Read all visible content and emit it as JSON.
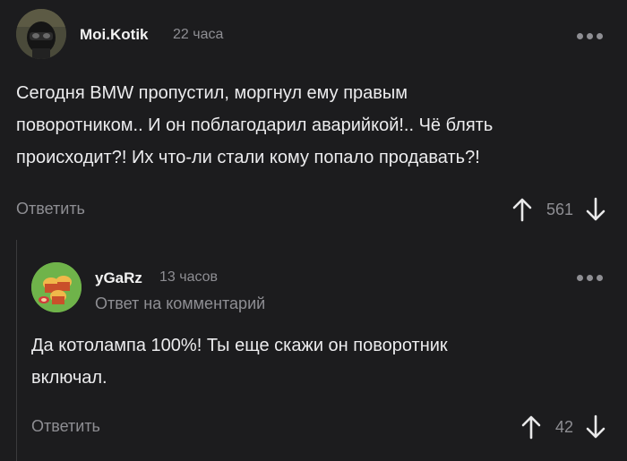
{
  "comments": [
    {
      "author": "Moi.Kotik",
      "time": "22 часа",
      "text": "Сегодня BMW пропустил, моргнул ему правым\nповоротником.. И он поблагодарил аварийкой!.. Чё блять\nпроисходит?! Их что-ли стали кому попало продавать?!",
      "reply_label": "Ответить",
      "score": "561"
    },
    {
      "author": "yGaRz",
      "time": "13 часов",
      "reply_hint": "Ответ на комментарий",
      "text": "Да котолампа 100%! Ты еще скажи он поворотник\nвключал.",
      "reply_label": "Ответить",
      "score": "42"
    }
  ],
  "icons": {
    "more": "more-dots-icon",
    "upvote": "arrow-up-icon",
    "downvote": "arrow-down-icon"
  },
  "colors": {
    "background": "#1c1c1e",
    "text": "#ececee",
    "muted": "#8e8e93"
  }
}
